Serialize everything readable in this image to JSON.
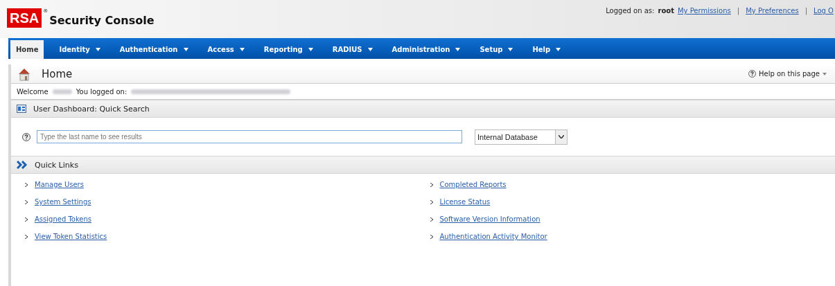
{
  "header": {
    "logo": "RSA",
    "logo_mark": "®",
    "title": "Security Console",
    "logged_on_label": "Logged on as:",
    "user": "root",
    "separator": "|",
    "links": [
      "My Permissions",
      "My Preferences",
      "Log O"
    ]
  },
  "nav": [
    {
      "label": "Home",
      "selected": true,
      "menu": false
    },
    {
      "label": "Identity",
      "selected": false,
      "menu": true
    },
    {
      "label": "Authentication",
      "selected": false,
      "menu": true
    },
    {
      "label": "Access",
      "selected": false,
      "menu": true
    },
    {
      "label": "Reporting",
      "selected": false,
      "menu": true
    },
    {
      "label": "RADIUS",
      "selected": false,
      "menu": true
    },
    {
      "label": "Administration",
      "selected": false,
      "menu": true
    },
    {
      "label": "Setup",
      "selected": false,
      "menu": true
    },
    {
      "label": "Help",
      "selected": false,
      "menu": true
    }
  ],
  "page": {
    "title": "Home",
    "help": "Help on this page",
    "welcome": "Welcome",
    "logged_on": "You logged on:"
  },
  "quick_search": {
    "title": "User Dashboard: Quick Search",
    "placeholder": "Type the last name to see results",
    "source": "Internal Database"
  },
  "quick_links": {
    "title": "Quick Links",
    "columns": [
      [
        "Manage Users",
        "System Settings",
        "Assigned Tokens",
        "View Token Statistics"
      ],
      [
        "Completed Reports",
        "License Status",
        "Software Version Information",
        "Authentication Activity Monitor"
      ]
    ]
  }
}
